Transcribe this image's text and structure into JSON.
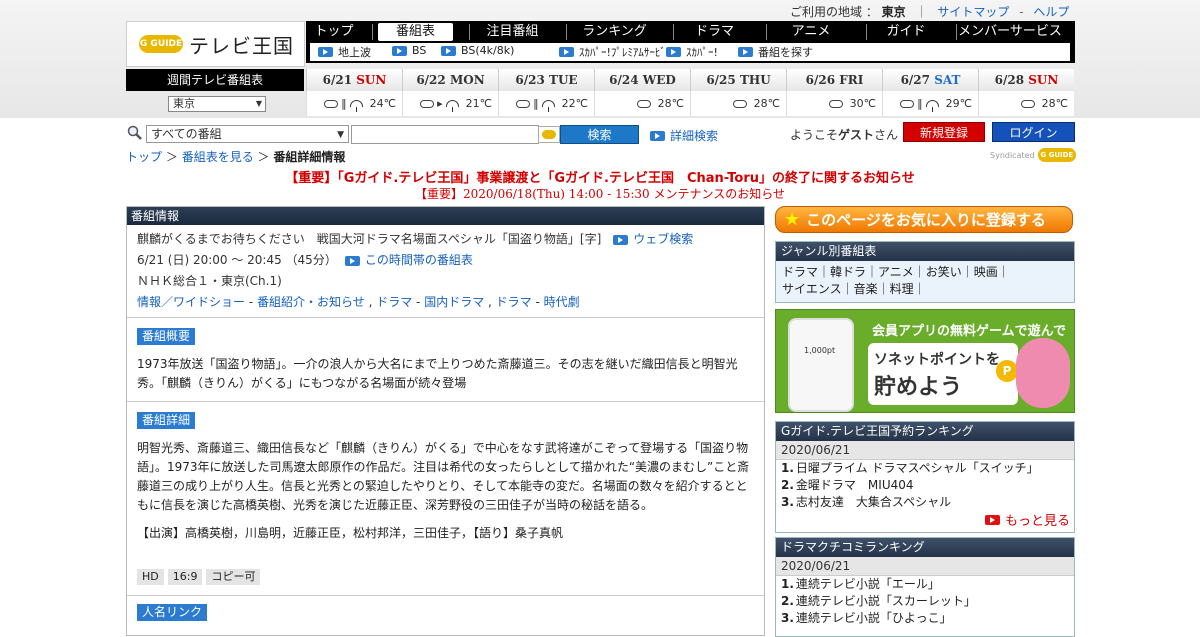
{
  "header": {
    "region_label": "ご利用の地域 ：",
    "region_value": "東京",
    "sitemap": "サイトマップ",
    "sep": "-",
    "help": "ヘルプ",
    "logo_badge": "G GUIDE",
    "logo_text": "テレビ王国"
  },
  "nav": {
    "tabs": [
      "トップ",
      "番組表",
      "注目番組",
      "ランキング",
      "ドラマ",
      "アニメ",
      "ガイド",
      "メンバーサービス"
    ],
    "active_index": 1,
    "subnav": [
      "地上波",
      "BS",
      "BS(4k/8k)",
      "ｽｶﾊﾟｰ!ﾌﾟﾚﾐｱﾑｻｰﾋﾞｽ",
      "ｽｶﾊﾟｰ!",
      "番組を探す"
    ]
  },
  "weekly": {
    "label": "週間テレビ番組表",
    "area": "東京",
    "days": [
      {
        "date": "6/21",
        "dow": "SUN",
        "type": "sun",
        "temp": "24℃",
        "wx": [
          "cloud",
          "bar",
          "umb"
        ]
      },
      {
        "date": "6/22",
        "dow": "MON",
        "type": "",
        "temp": "21℃",
        "wx": [
          "cloud",
          "arrow",
          "umb"
        ]
      },
      {
        "date": "6/23",
        "dow": "TUE",
        "type": "",
        "temp": "22℃",
        "wx": [
          "cloud",
          "bar",
          "umb"
        ]
      },
      {
        "date": "6/24",
        "dow": "WED",
        "type": "",
        "temp": "28℃",
        "wx": [
          "cloud"
        ]
      },
      {
        "date": "6/25",
        "dow": "THU",
        "type": "",
        "temp": "28℃",
        "wx": [
          "cloud"
        ]
      },
      {
        "date": "6/26",
        "dow": "FRI",
        "type": "",
        "temp": "30℃",
        "wx": [
          "cloud"
        ]
      },
      {
        "date": "6/27",
        "dow": "SAT",
        "type": "sat",
        "temp": "29℃",
        "wx": [
          "cloud",
          "bar",
          "umb"
        ]
      },
      {
        "date": "6/28",
        "dow": "SUN",
        "type": "sun",
        "temp": "28℃",
        "wx": [
          "cloud"
        ]
      }
    ]
  },
  "search": {
    "category": "すべての番組",
    "button": "検索",
    "advanced": "詳細検索",
    "welcome_prefix": "ようこそ",
    "welcome_user": "ゲスト",
    "welcome_suffix": "さん",
    "register": "新規登録",
    "login": "ログイン"
  },
  "breadcrumb": {
    "top": "トップ",
    "sep": "＞",
    "schedule": "番組表を見る",
    "current": "番組詳細情報"
  },
  "syndicated": {
    "label": "Syndicated",
    "badge": "G GUIDE"
  },
  "notices": {
    "line1": "【重要】「Gガイド.テレビ王国」事業譲渡と「Gガイド.テレビ王国　Chan-Toru」の終了に関するお知らせ",
    "line2": "【重要】2020/06/18(Thu) 14:00 - 15:30 メンテナンスのお知らせ"
  },
  "program": {
    "panel_title": "番組情報",
    "title": "麒麟がくるまでお待ちください　戦国大河ドラマ名場面スペシャル「国盗り物語」[字]",
    "web_search": "ウェブ検索",
    "time": "6/21 (日) 20:00 ～ 20:45 （45分）",
    "time_link": "この時間帯の番組表",
    "channel": "ＮＨＫ総合１・東京(Ch.1)",
    "genres": [
      {
        "a": "情報／ワイドショー",
        "b": "番組紹介・お知らせ"
      },
      {
        "a": "ドラマ",
        "b": "国内ドラマ"
      },
      {
        "a": "ドラマ",
        "b": "時代劇"
      }
    ],
    "summary_label": "番組概要",
    "summary": "1973年放送「国盗り物語」。一介の浪人から大名にまで上りつめた斎藤道三。その志を継いだ織田信長と明智光秀。「麒麟（きりん）がくる」にもつながる名場面が続々登場",
    "detail_label": "番組詳細",
    "detail": "明智光秀、斎藤道三、織田信長など「麒麟（きりん）がくる」で中心をなす武将達がこぞって登場する「国盗り物語」。1973年に放送した司馬遼太郎原作の作品だ。注目は希代の女ったらしとして描かれた“美濃のまむし”こと斎藤道三の成り上がり人生。信長と光秀との緊迫したやりとり、そして本能寺の変だ。名場面の数々を紹介するとともに信長を演じた高橋英樹、光秀を演じた近藤正臣、深芳野役の三田佳子が当時の秘話を語る。",
    "cast": "【出演】高橋英樹，川島明，近藤正臣，松村邦洋，三田佳子，【語り】桑子真帆",
    "badges": [
      "HD",
      "16:9",
      "コピー可"
    ],
    "next_label": "人名リンク"
  },
  "sidebar": {
    "favorite": "このページをお気に入りに登録する",
    "genre_title": "ジャンル別番組表",
    "genre_lines": [
      "ドラマ｜韓ドラ｜アニメ｜お笑い｜映画｜",
      "サイエンス｜音楽｜料理｜"
    ],
    "ad_line1": "会員アプリの無料ゲームで遊んで",
    "ad_line2": "ソネットポイントを",
    "ad_line3": "貯めよう",
    "ad_points": "1,000pt",
    "ad_coin": "P",
    "ranking_title": "Gガイド.テレビ王国予約ランキング",
    "ranking_date": "2020/06/21",
    "ranking": [
      "日曜プライム ドラマスペシャル「スイッチ」",
      "金曜ドラマ　MIU404",
      "志村友達　大集合スペシャル"
    ],
    "more": "もっと見る",
    "drama_title": "ドラマクチコミランキング",
    "drama_date": "2020/06/21",
    "drama": [
      "連続テレビ小説「エール」",
      "連続テレビ小説「スカーレット」",
      "連続テレビ小説「ひよっこ」"
    ]
  }
}
